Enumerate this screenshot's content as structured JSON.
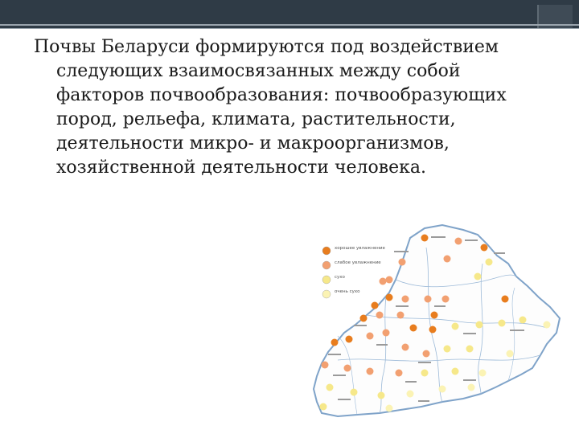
{
  "slide": {
    "text": "Почвы Беларуси формируются под воздействием следующих взаимосвязанных между собой факторов почвообразования: почвообразующих пород, рельефа, климата, растительности, деятельности микро- и макроорганизмов, хозяйственной деятельности человека."
  },
  "map": {
    "legend": [
      {
        "label": "хорошее увлажнение",
        "color": "#e87d1e"
      },
      {
        "label": "слабое увлажнение",
        "color": "#f2a071"
      },
      {
        "label": "сухо",
        "color": "#f6e88a"
      },
      {
        "label": "очень сухо",
        "color": "#fbf3b4"
      }
    ],
    "colors": {
      "orange": "#e87d1e",
      "salmon": "#f2a071",
      "yellow": "#f6e88a",
      "pale": "#fbf3b4",
      "outline": "#7fa3c9"
    }
  }
}
